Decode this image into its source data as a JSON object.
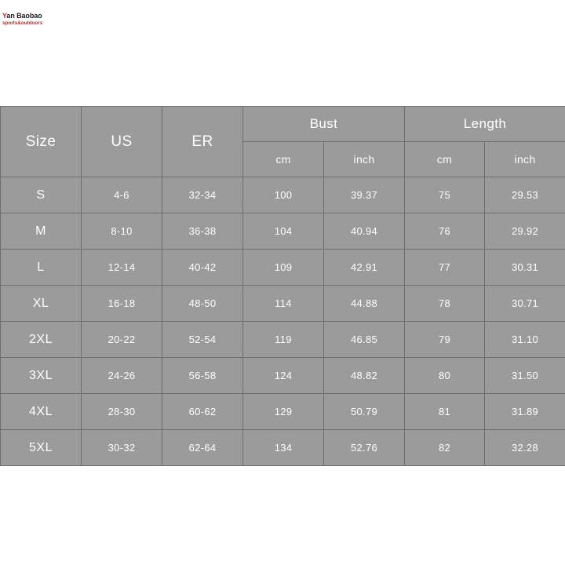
{
  "brand": {
    "name_accent": "Y",
    "name_rest": "an Baobao",
    "tagline": "sports&outdoors",
    "accent_color": "#d8232a"
  },
  "table": {
    "colors": {
      "cell_background": "#9b9b9b",
      "grid_line": "#6e6e6e",
      "text": "#ffffff",
      "page_background": "#ffffff"
    },
    "headers": {
      "size": "Size",
      "us": "US",
      "er": "ER",
      "bust": "Bust",
      "length": "Length",
      "bust_cm": "cm",
      "bust_inch": "inch",
      "length_cm": "cm",
      "length_inch": "inch"
    },
    "rows": [
      {
        "size": "S",
        "us": "4-6",
        "er": "32-34",
        "bust_cm": "100",
        "bust_inch": "39.37",
        "length_cm": "75",
        "length_inch": "29.53"
      },
      {
        "size": "M",
        "us": "8-10",
        "er": "36-38",
        "bust_cm": "104",
        "bust_inch": "40.94",
        "length_cm": "76",
        "length_inch": "29.92"
      },
      {
        "size": "L",
        "us": "12-14",
        "er": "40-42",
        "bust_cm": "109",
        "bust_inch": "42.91",
        "length_cm": "77",
        "length_inch": "30.31"
      },
      {
        "size": "XL",
        "us": "16-18",
        "er": "48-50",
        "bust_cm": "114",
        "bust_inch": "44.88",
        "length_cm": "78",
        "length_inch": "30.71"
      },
      {
        "size": "2XL",
        "us": "20-22",
        "er": "52-54",
        "bust_cm": "119",
        "bust_inch": "46.85",
        "length_cm": "79",
        "length_inch": "31.10"
      },
      {
        "size": "3XL",
        "us": "24-26",
        "er": "56-58",
        "bust_cm": "124",
        "bust_inch": "48.82",
        "length_cm": "80",
        "length_inch": "31.50"
      },
      {
        "size": "4XL",
        "us": "28-30",
        "er": "60-62",
        "bust_cm": "129",
        "bust_inch": "50.79",
        "length_cm": "81",
        "length_inch": "31.89"
      },
      {
        "size": "5XL",
        "us": "30-32",
        "er": "62-64",
        "bust_cm": "134",
        "bust_inch": "52.76",
        "length_cm": "82",
        "length_inch": "32.28"
      }
    ]
  }
}
